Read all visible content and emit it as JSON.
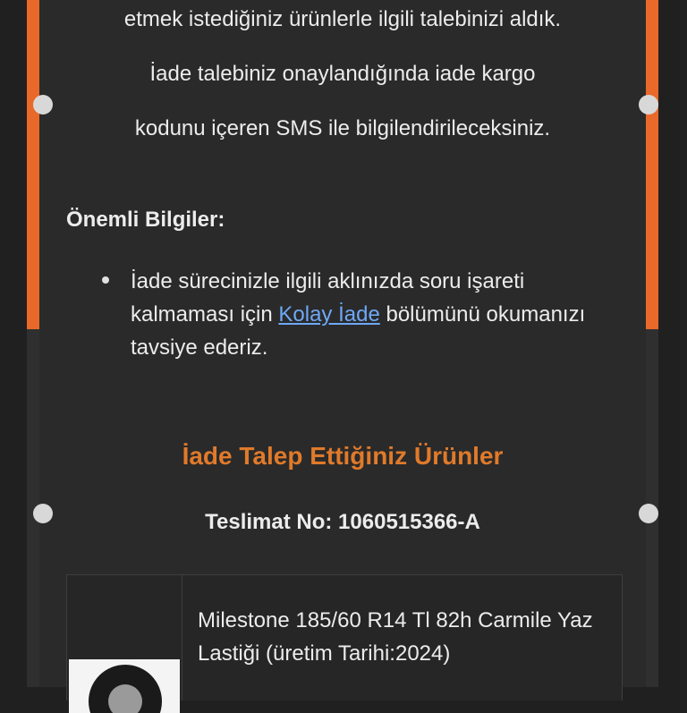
{
  "message": {
    "line1": "etmek istediğiniz ürünlerle ilgili talebinizi aldık.",
    "line2": "İade talebiniz onaylandığında iade kargo",
    "line3": "kodunu içeren SMS ile bilgilendirileceksiniz."
  },
  "important": {
    "title": "Önemli Bilgiler:",
    "bullet_before": "İade sürecinizle ilgili aklınızda soru işareti kalmaması için ",
    "link_text": "Kolay İade",
    "bullet_after": " bölümünü okumanızı tavsiye ederiz."
  },
  "returns": {
    "title": "İade Talep Ettiğiniz Ürünler",
    "delivery_no": "Teslimat No: 1060515366-A"
  },
  "product": {
    "name": "Milestone 185/60 R14 Tl 82h Carmile Yaz Lastiği (üretim Tarihi:2024)",
    "image_icon": "tire-image"
  },
  "colors": {
    "accent": "#e8692a",
    "link": "#6ea8f7",
    "section_title": "#e07a2a",
    "background": "#202020"
  }
}
